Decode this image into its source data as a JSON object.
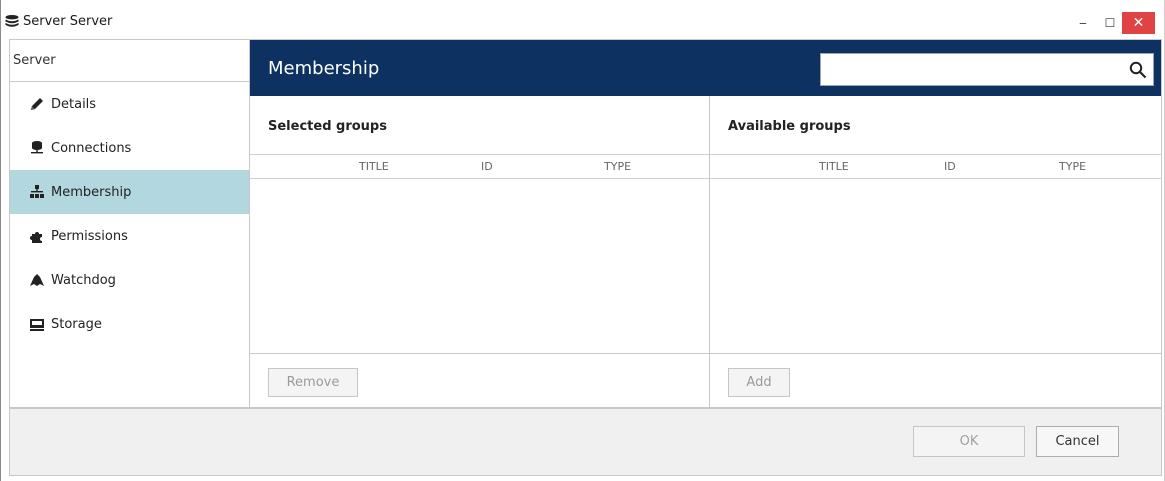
{
  "window": {
    "title": "Server Server",
    "minimize_glyph": "‒",
    "maximize_glyph": "☐",
    "close_glyph": "✕",
    "close_color": "#e04343"
  },
  "sidebar": {
    "header": "Server",
    "items": [
      {
        "label": "Details",
        "icon": "pencil-icon",
        "active": false
      },
      {
        "label": "Connections",
        "icon": "network-icon",
        "active": false
      },
      {
        "label": "Membership",
        "icon": "hierarchy-icon",
        "active": true
      },
      {
        "label": "Permissions",
        "icon": "puzzle-icon",
        "active": false
      },
      {
        "label": "Watchdog",
        "icon": "dog-icon",
        "active": false
      },
      {
        "label": "Storage",
        "icon": "drive-icon",
        "active": false
      }
    ],
    "active_color": "#b3d7df"
  },
  "main": {
    "title": "Membership",
    "header_color": "#0d3161",
    "search": {
      "value": "",
      "placeholder": ""
    },
    "selected_groups": {
      "title": "Selected groups",
      "columns": [
        "TITLE",
        "ID",
        "TYPE"
      ],
      "rows": [],
      "button_label": "Remove"
    },
    "available_groups": {
      "title": "Available groups",
      "columns": [
        "TITLE",
        "ID",
        "TYPE"
      ],
      "rows": [],
      "button_label": "Add"
    }
  },
  "footer": {
    "ok_label": "OK",
    "cancel_label": "Cancel"
  }
}
